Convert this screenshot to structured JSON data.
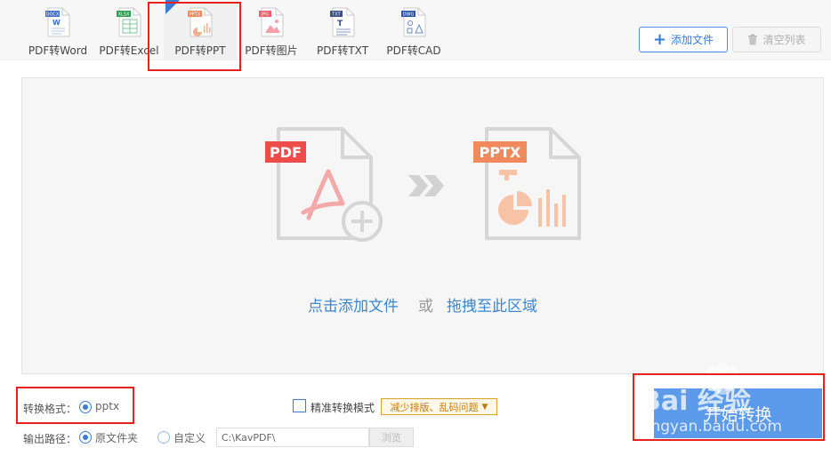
{
  "toolbar": {
    "tools": [
      {
        "label": "PDF转Word",
        "badge": "DOCX",
        "color": "#3f6ec6"
      },
      {
        "label": "PDF转Excel",
        "badge": "XLSX",
        "color": "#2e9e55"
      },
      {
        "label": "PDF转PPT",
        "badge": "PPTX",
        "color": "#f08a5d"
      },
      {
        "label": "PDF转图片",
        "badge": "JPG",
        "color": "#ee5f6c"
      },
      {
        "label": "PDF转TXT",
        "badge": "TXT",
        "color": "#3b4f86"
      },
      {
        "label": "PDF转CAD",
        "badge": "DWG",
        "color": "#2f57a8"
      }
    ],
    "active_tool": "PDF转PPT",
    "add_file_label": "添加文件",
    "clear_list_label": "清空列表"
  },
  "drop_area": {
    "source_badge": "PDF",
    "target_badge": "PPTX",
    "add_link": "点击添加文件",
    "or_text": "或",
    "drag_link": "拖拽至此区域"
  },
  "format": {
    "label": "转换格式：",
    "value": "pptx"
  },
  "precise": {
    "label": "精准转换模式",
    "checked": false,
    "tag": "减少排版、乱码问题"
  },
  "output": {
    "label": "输出路径：",
    "option_original": "原文件夹",
    "option_custom": "自定义",
    "path_value": "C:\\KavPDF\\",
    "browse_label": "浏览"
  },
  "start_button": "开始转换",
  "watermark": {
    "line1": "Bai 经验",
    "line2": "jingyan.baidu.com"
  },
  "colors": {
    "accent": "#3a7bd5",
    "start_button": "#5c9aeb",
    "pdf_red": "#ee4b4b",
    "pptx_orange": "#f08a5d",
    "highlight_box": "#e8201e"
  }
}
